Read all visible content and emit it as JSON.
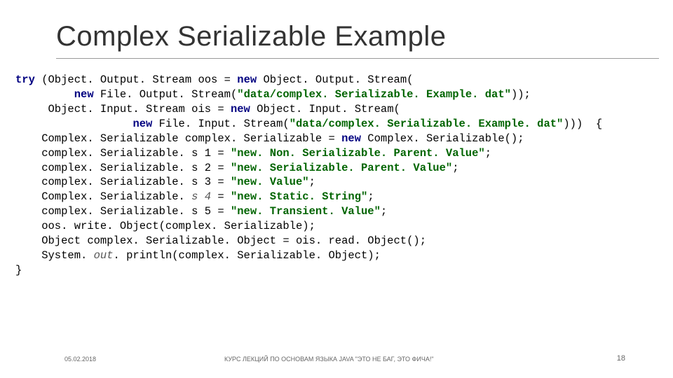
{
  "title": "Complex Serializable Example",
  "code": {
    "l1a": "try",
    "l1b": " (Object. Output. Stream oos = ",
    "l1c": "new ",
    "l1d": "Object. Output. Stream(",
    "l2a": "         ",
    "l2b": "new ",
    "l2c": "File. Output. Stream(",
    "l2d": "\"data/complex. Serializable. Example. dat\"",
    "l2e": "));",
    "l3a": "     Object. Input. Stream ois = ",
    "l3b": "new ",
    "l3c": "Object. Input. Stream(",
    "l4a": "                  ",
    "l4b": "new ",
    "l4c": "File. Input. Stream(",
    "l4d": "\"data/complex. Serializable. Example. dat\"",
    "l4e": ")))  {",
    "l5a": "    Complex. Serializable complex. Serializable = ",
    "l5b": "new ",
    "l5c": "Complex. Serializable();",
    "l6a": "    complex. Serializable. s 1 = ",
    "l6b": "\"new. Non. Serializable. Parent. Value\"",
    "l6c": ";",
    "l7a": "    complex. Serializable. s 2 = ",
    "l7b": "\"new. Serializable. Parent. Value\"",
    "l7c": ";",
    "l8a": "    complex. Serializable. s 3 = ",
    "l8b": "\"new. Value\"",
    "l8c": ";",
    "l9a": "    Complex. Serializable. ",
    "l9b": "s 4 ",
    "l9c": "= ",
    "l9d": "\"new. Static. String\"",
    "l9e": ";",
    "l10a": "    complex. Serializable. s 5 = ",
    "l10b": "\"new. Transient. Value\"",
    "l10c": ";",
    "l11": "    oos. write. Object(complex. Serializable);",
    "l12": "    Object complex. Serializable. Object = ois. read. Object();",
    "l13a": "    System. ",
    "l13b": "out",
    "l13c": ". println(complex. Serializable. Object);",
    "l14": "}"
  },
  "footer": {
    "date": "05.02.2018",
    "center": "КУРС ЛЕКЦИЙ ПО ОСНОВАМ ЯЗЫКА JAVA \"ЭТО НЕ БАГ, ЭТО ФИЧА!\"",
    "page": "18"
  }
}
